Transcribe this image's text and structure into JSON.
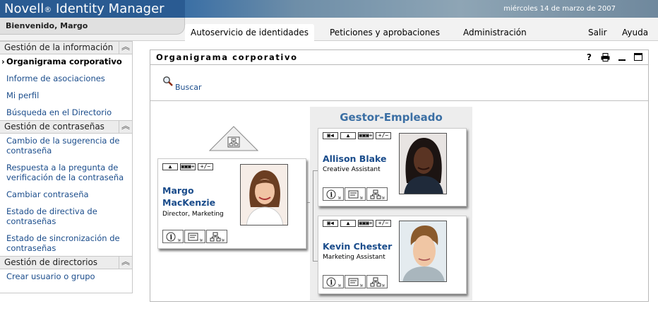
{
  "app": {
    "brand": "Novell",
    "brand_reg": "®",
    "product": "Identity Manager",
    "date": "miércoles 14 de marzo de 2007"
  },
  "nav": {
    "welcome": "Bienvenido, Margo",
    "tabs": [
      {
        "label": "Autoservicio de identidades",
        "active": true
      },
      {
        "label": "Peticiones y aprobaciones",
        "active": false
      },
      {
        "label": "Administración",
        "active": false
      }
    ],
    "links": {
      "logout": "Salir",
      "help": "Ayuda"
    }
  },
  "sidebar": {
    "sections": [
      {
        "title": "Gestión de la información",
        "items": [
          {
            "label": "Organigrama corporativo",
            "current": true
          },
          {
            "label": "Informe de asociaciones"
          },
          {
            "label": "Mi perfil"
          },
          {
            "label": "Búsqueda en el Directorio"
          }
        ]
      },
      {
        "title": "Gestión de contraseñas",
        "items": [
          {
            "label": "Cambio de la sugerencia de contraseña"
          },
          {
            "label": "Respuesta a la pregunta de verificación de la contraseña"
          },
          {
            "label": "Cambiar contraseña"
          },
          {
            "label": "Estado de directiva de contraseñas"
          },
          {
            "label": "Estado de sincronización de contraseñas"
          }
        ]
      },
      {
        "title": "Gestión de directorios",
        "items": [
          {
            "label": "Crear usuario o grupo"
          }
        ]
      }
    ]
  },
  "portlet": {
    "title": "Organigrama corporativo",
    "controls": {
      "help": "?",
      "print": "print-icon",
      "minimize": "minimize-icon",
      "maximize": "maximize-icon"
    },
    "search_label": "Buscar"
  },
  "orgchart": {
    "relationship": "Gestor-Empleado",
    "card_buttons": {
      "a": "▣◀",
      "up": "▲",
      "b": "▣▣▣+",
      "toggle": "+/−"
    },
    "manager": {
      "name_line1": "Margo",
      "name_line2": "MacKenzie",
      "title": "Director, Marketing"
    },
    "employees": [
      {
        "name": "Allison Blake",
        "title": "Creative Assistant"
      },
      {
        "name": "Kevin Chester",
        "title": "Marketing Assistant"
      }
    ]
  },
  "colors": {
    "link": "#1a4c8b",
    "banner": "#2a5b92",
    "group_title": "#3b6fa4"
  }
}
